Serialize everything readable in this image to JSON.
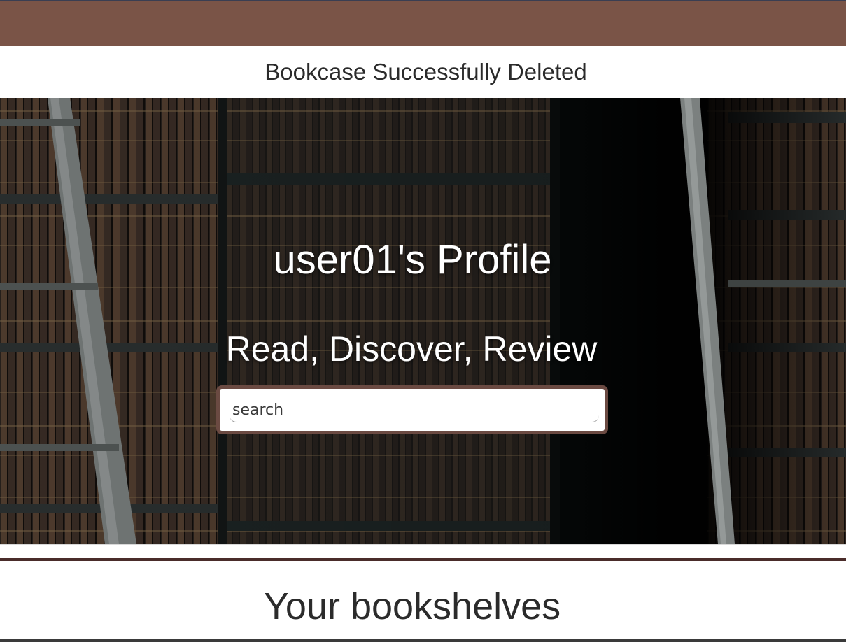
{
  "flash": {
    "message": "Bookcase Successfully Deleted"
  },
  "hero": {
    "title": "user01's Profile",
    "tagline": "Read, Discover, Review",
    "background": "library-bookshelves-photo"
  },
  "search": {
    "placeholder": "search",
    "value": ""
  },
  "bookshelves": {
    "title": "Your bookshelves"
  },
  "colors": {
    "navbar": "#7a5447",
    "search_border": "#6b4a42",
    "divider": "#4a2c2a"
  }
}
